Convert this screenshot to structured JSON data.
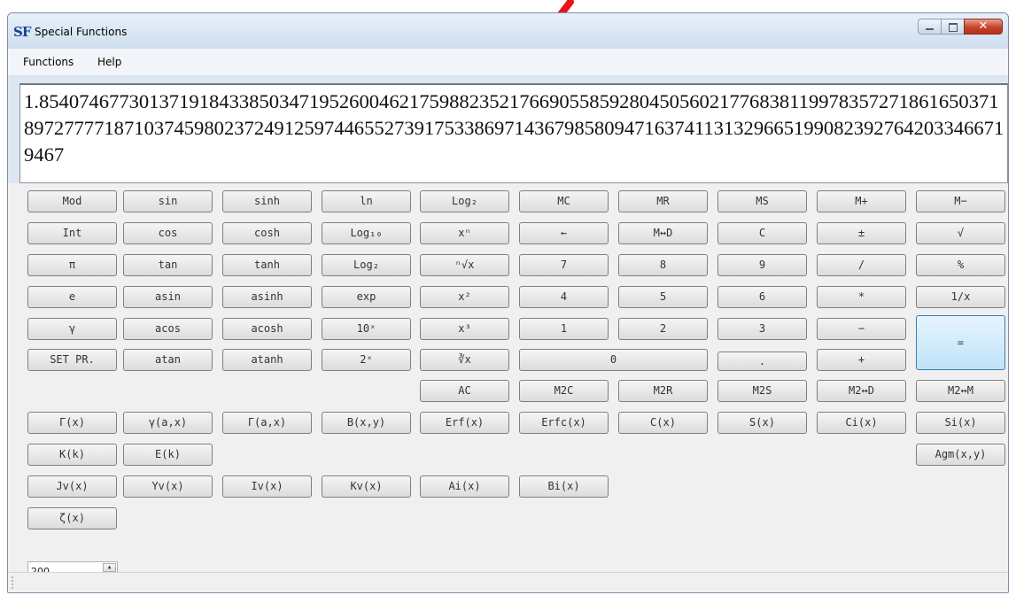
{
  "window": {
    "title": "Special Functions",
    "icon": "SF"
  },
  "menu": [
    "Functions",
    "Help"
  ],
  "display": {
    "value": "1.854074677301371918433850347195260046217598823521766905585928045056021776838119978357271861650371897277771871037459802372491259744655273917533869714367985809471637411313296651990823927642033466719467"
  },
  "precision": {
    "value": "200"
  },
  "buttons": {
    "row1": [
      "Mod",
      "sin",
      "sinh",
      "ln",
      "Log₂",
      "MC",
      "MR",
      "MS",
      "M+",
      "M−"
    ],
    "row2": [
      "Int",
      "cos",
      "cosh",
      "Log₁₀",
      "xⁿ",
      "←",
      "M↔D",
      "C",
      "±",
      "√"
    ],
    "row3": [
      "π",
      "tan",
      "tanh",
      "Log₂",
      "ⁿ√x",
      "7",
      "8",
      "9",
      "/",
      "%"
    ],
    "row4": [
      "e",
      "asin",
      "asinh",
      "exp",
      "x²",
      "4",
      "5",
      "6",
      "*",
      "1/x"
    ],
    "row5": [
      "γ",
      "acos",
      "acosh",
      "10ˣ",
      "x³",
      "1",
      "2",
      "3",
      "−"
    ],
    "equals": "=",
    "row6": [
      "SET PR.",
      "atan",
      "atanh",
      "2ˣ",
      "∛x"
    ],
    "zero": "0",
    "dot": ".",
    "plus": "+",
    "row7": [
      "AC",
      "M2C",
      "M2R",
      "M2S",
      "M2↔D",
      "M2↔M"
    ],
    "row8": [
      "Γ(x)",
      "γ(a,x)",
      "Γ(a,x)",
      "B(x,y)",
      "Erf(x)",
      "Erfc(x)",
      "C(x)",
      "S(x)",
      "Ci(x)",
      "Si(x)"
    ],
    "row9": [
      "K(k)",
      "E(k)"
    ],
    "agm": "Agm(x,y)",
    "row10": [
      "Jv(x)",
      "Yv(x)",
      "Iv(x)",
      "Kv(x)",
      "Ai(x)",
      "Bi(x)"
    ],
    "row11": [
      "ζ(x)"
    ]
  },
  "colors": {
    "annotation_arrow": "#e8141a",
    "equals_button": "#bfe2f8"
  }
}
